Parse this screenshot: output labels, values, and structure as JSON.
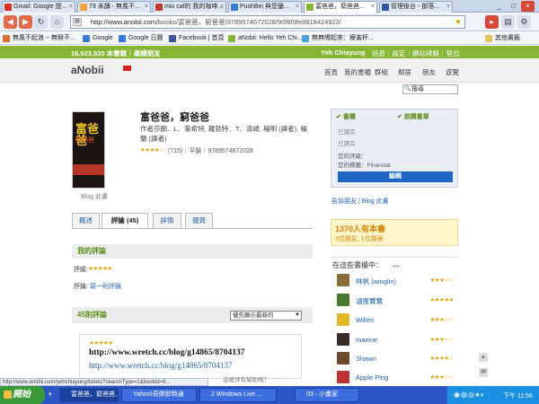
{
  "browser": {
    "tabs": [
      {
        "label": "Gmail: Google 提...",
        "fav": "#d93025"
      },
      {
        "label": "79 未讀 - 無風不...",
        "fav": "#f2a43a"
      },
      {
        "label": "mio caf的 我的咖啡...",
        "fav": "#c0392b"
      },
      {
        "label": "PushBei 與您優...",
        "fav": "#3a7bd5"
      },
      {
        "label": "富爸爸，窮爸爸...",
        "fav": "#85b735"
      },
      {
        "label": "管理後台 - 部落...",
        "fav": "#2e5aa8"
      }
    ],
    "url_domain": "http://www.anobii.com",
    "url_path": "/books/富爸爸，窮爸爸/9789574672028/90f8f9fe8818424923/",
    "bookmarks": [
      "無風不起浪 ~ 無掰不...",
      "Google",
      "Google 日曆",
      "Facebook | 首頁",
      "aNobii: Hello Yeh Chi...",
      "無無嘟起來：療害杯..."
    ],
    "other_bookmarks": "其他書籤"
  },
  "site": {
    "counter": "16,923,520 本書籍｜邀請朋友",
    "username": "Yeh Chiayung",
    "user_links": "訊息｜設定｜網站排解｜登出",
    "logo": "aNobii",
    "nav": [
      "首頁",
      "我的書櫃",
      "群組",
      "鄰居",
      "朋友",
      "遊覽"
    ],
    "search_placeholder": "搜尋"
  },
  "book": {
    "title": "富爸爸，窮爸爸",
    "authors": "作者莎朗．L．萊希特, 羅勃特．T．清崎, 楊明 (譯者), 楊蘭 (譯者)",
    "rating_line": "(715)｜平裝｜9789574672028",
    "cover_title": "富爸爸",
    "cover_sub": "窮爸爸",
    "blog_label": "Blog 此書"
  },
  "tabs": [
    "概述",
    "評論 (45)",
    "詳情",
    "擺買"
  ],
  "my_review": {
    "heading": "我的評論",
    "rating_label": "評級:",
    "review_label": "評論:",
    "review_link": "寫一則評論"
  },
  "reviews": {
    "heading": "45則評論",
    "sort": "優先顯示最新的",
    "text1": "http://www.wretch.cc/blog/g14865/8704137",
    "text2": "http://www.wretch.cc/blog/g14865/8704137",
    "helpful": "這被評有幫助嗎？"
  },
  "panel": {
    "shelf": "書櫃",
    "wishlist": "欲購書單",
    "read1": "已讀完",
    "read2": "已讀完",
    "my_rating": "您的評級：",
    "my_tag": "您的標籤：Financial",
    "edit": "編輯",
    "links": "告訴朋友 | Blog 此書"
  },
  "owners": {
    "count": "1370人有本書",
    "sub": "3位朋友, 1位鄰居",
    "heading": "在這些書櫃中：",
    "users": [
      {
        "name": "林帆 (winglin)",
        "color": "#8a6b3a",
        "stars": "★★★☆☆"
      },
      {
        "name": "滷蛋寶寶",
        "color": "#4a7a30",
        "stars": "★★★★★"
      },
      {
        "name": "Willen",
        "color": "#e0b82a",
        "stars": "★★★☆☆"
      },
      {
        "name": "maxine",
        "color": "#3a2a28",
        "stars": "★★★☆☆"
      },
      {
        "name": "Shawn",
        "color": "#6b4a30",
        "stars": "★★★★☆"
      },
      {
        "name": "Apple Ping",
        "color": "#c03030",
        "stars": "★★★☆☆"
      }
    ]
  },
  "status_text": "http://www.anobii.com/yehchiayung/books?searchType=1&bookId=9...",
  "taskbar": {
    "start": "開始",
    "tasks": [
      "富爸爸，窮爸爸...",
      "Yahoo!奇摩即時通",
      "2 Windows Live ...",
      "03 - 小畫家"
    ],
    "clock": "下午 11:56"
  }
}
